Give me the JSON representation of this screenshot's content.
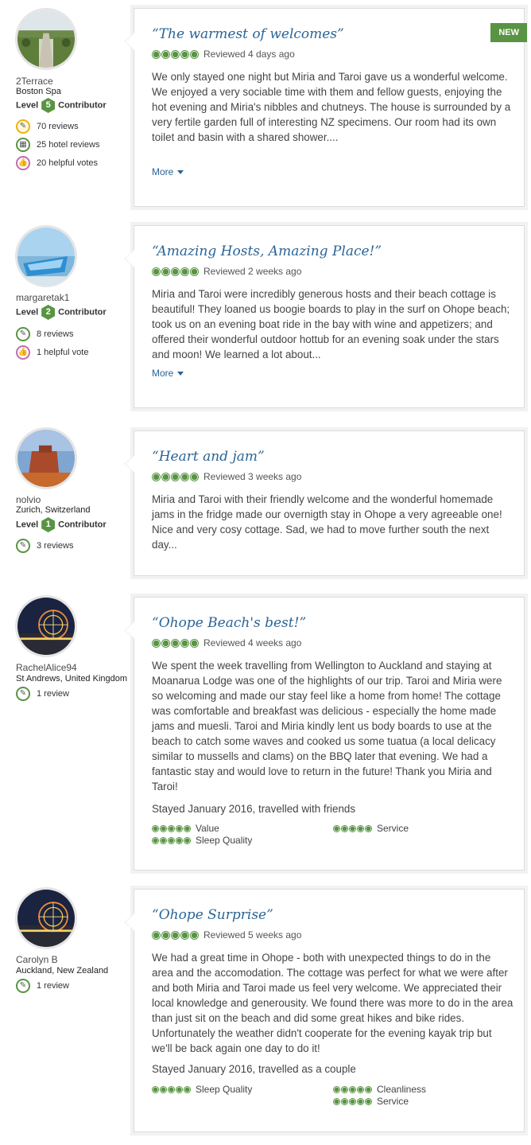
{
  "reviews": [
    {
      "username": "2Terrace",
      "location": "Boston Spa",
      "level_prefix": "Level",
      "level": "5",
      "level_suffix": "Contributor",
      "badges": [
        {
          "icon": "review-count-icon",
          "text": "70 reviews"
        },
        {
          "icon": "hotel-reviews-icon",
          "text": "25 hotel reviews"
        },
        {
          "icon": "helpful-votes-icon",
          "text": "20 helpful votes"
        }
      ],
      "is_new": true,
      "new_label": "NEW",
      "title": "“The warmest of welcomes”",
      "rating": 5,
      "date": "Reviewed 4 days ago",
      "text": "We only stayed one night but Miria and Taroi gave us a wonderful welcome. We enjoyed a very sociable time with them and fellow guests, enjoying the hot evening and Miria's nibbles and chutneys. The house is surrounded by a very fertile garden full of interesting NZ specimens. Our room had its own toilet and basin with a shared shower....",
      "more": "More"
    },
    {
      "username": "margaretak1",
      "location": "",
      "level_prefix": "Level",
      "level": "2",
      "level_suffix": "Contributor",
      "badges": [
        {
          "icon": "review-count-icon",
          "text": "8 reviews"
        },
        {
          "icon": "helpful-votes-icon",
          "text": "1 helpful vote"
        }
      ],
      "title": "“Amazing Hosts, Amazing Place!”",
      "rating": 5,
      "date": "Reviewed 2 weeks ago",
      "text": "Miria and Taroi were incredibly generous hosts and their beach cottage is beautiful! They loaned us boogie boards to play in the surf on Ohope beach; took us on an evening boat ride in the bay with wine and appetizers; and offered their wonderful outdoor hottub for an evening soak under the stars and moon! We learned a lot about...",
      "more": "More"
    },
    {
      "username": "nolvio",
      "location": "Zurich, Switzerland",
      "level_prefix": "Level",
      "level": "1",
      "level_suffix": "Contributor",
      "badges": [
        {
          "icon": "review-count-icon",
          "text": "3 reviews"
        }
      ],
      "title": "“Heart and jam”",
      "rating": 5,
      "date": "Reviewed 3 weeks ago",
      "text": "Miria and Taroi with their friendly welcome and the wonderful homemade jams in the fridge made our overnigth stay in Ohope a very agreeable one! Nice and very cosy cottage. Sad, we had to move further south the next day..."
    },
    {
      "username": "RachelAlice94",
      "location": "St Andrews, United Kingdom",
      "badges": [
        {
          "icon": "review-count-icon",
          "text": "1 review"
        }
      ],
      "title": "“Ohope Beach's best!”",
      "rating": 5,
      "date": "Reviewed 4 weeks ago",
      "text": "We spent the week travelling from Wellington to Auckland and staying at Moanarua Lodge was one of the highlights of our trip. Taroi and Miria were so welcoming and made our stay feel like a home from home! The cottage was comfortable and breakfast was delicious - especially the home made jams and muesli. Taroi and Miria kindly lent us body boards to use at the beach to catch some waves and cooked us some tuatua (a local delicacy similar to mussells and clams) on the BBQ later that evening. We had a fantastic stay and would love to return in the future! Thank you Miria and Taroi!",
      "stayed": "Stayed January 2016, travelled with friends",
      "subratings_left": [
        {
          "label": "Value",
          "rating": 5
        },
        {
          "label": "Sleep Quality",
          "rating": 5
        }
      ],
      "subratings_right": [
        {
          "label": "Service",
          "rating": 5
        }
      ]
    },
    {
      "username": "Carolyn B",
      "location": "Auckland, New Zealand",
      "badges": [
        {
          "icon": "review-count-icon",
          "text": "1 review"
        }
      ],
      "title": "“Ohope Surprise”",
      "rating": 5,
      "date": "Reviewed 5 weeks ago",
      "text": "We had a great time in Ohope - both with unexpected things to do in the area and the accomodation. The cottage was perfect for what we were after and both Miria and Taroi made us feel very welcome. We appreciated their local knowledge and generousity. We found there was more to do in the area than just sit on the beach and did some great hikes and bike rides. Unfortunately the weather didn't cooperate for the evening kayak trip but we'll be back again one day to do it!",
      "stayed": "Stayed January 2016, travelled as a couple",
      "subratings_left": [
        {
          "label": "Sleep Quality",
          "rating": 5
        }
      ],
      "subratings_right": [
        {
          "label": "Cleanliness",
          "rating": 5
        },
        {
          "label": "Service",
          "rating": 5
        }
      ]
    }
  ],
  "colors": {
    "brand_green": "#589442",
    "link_blue": "#2a6496"
  }
}
